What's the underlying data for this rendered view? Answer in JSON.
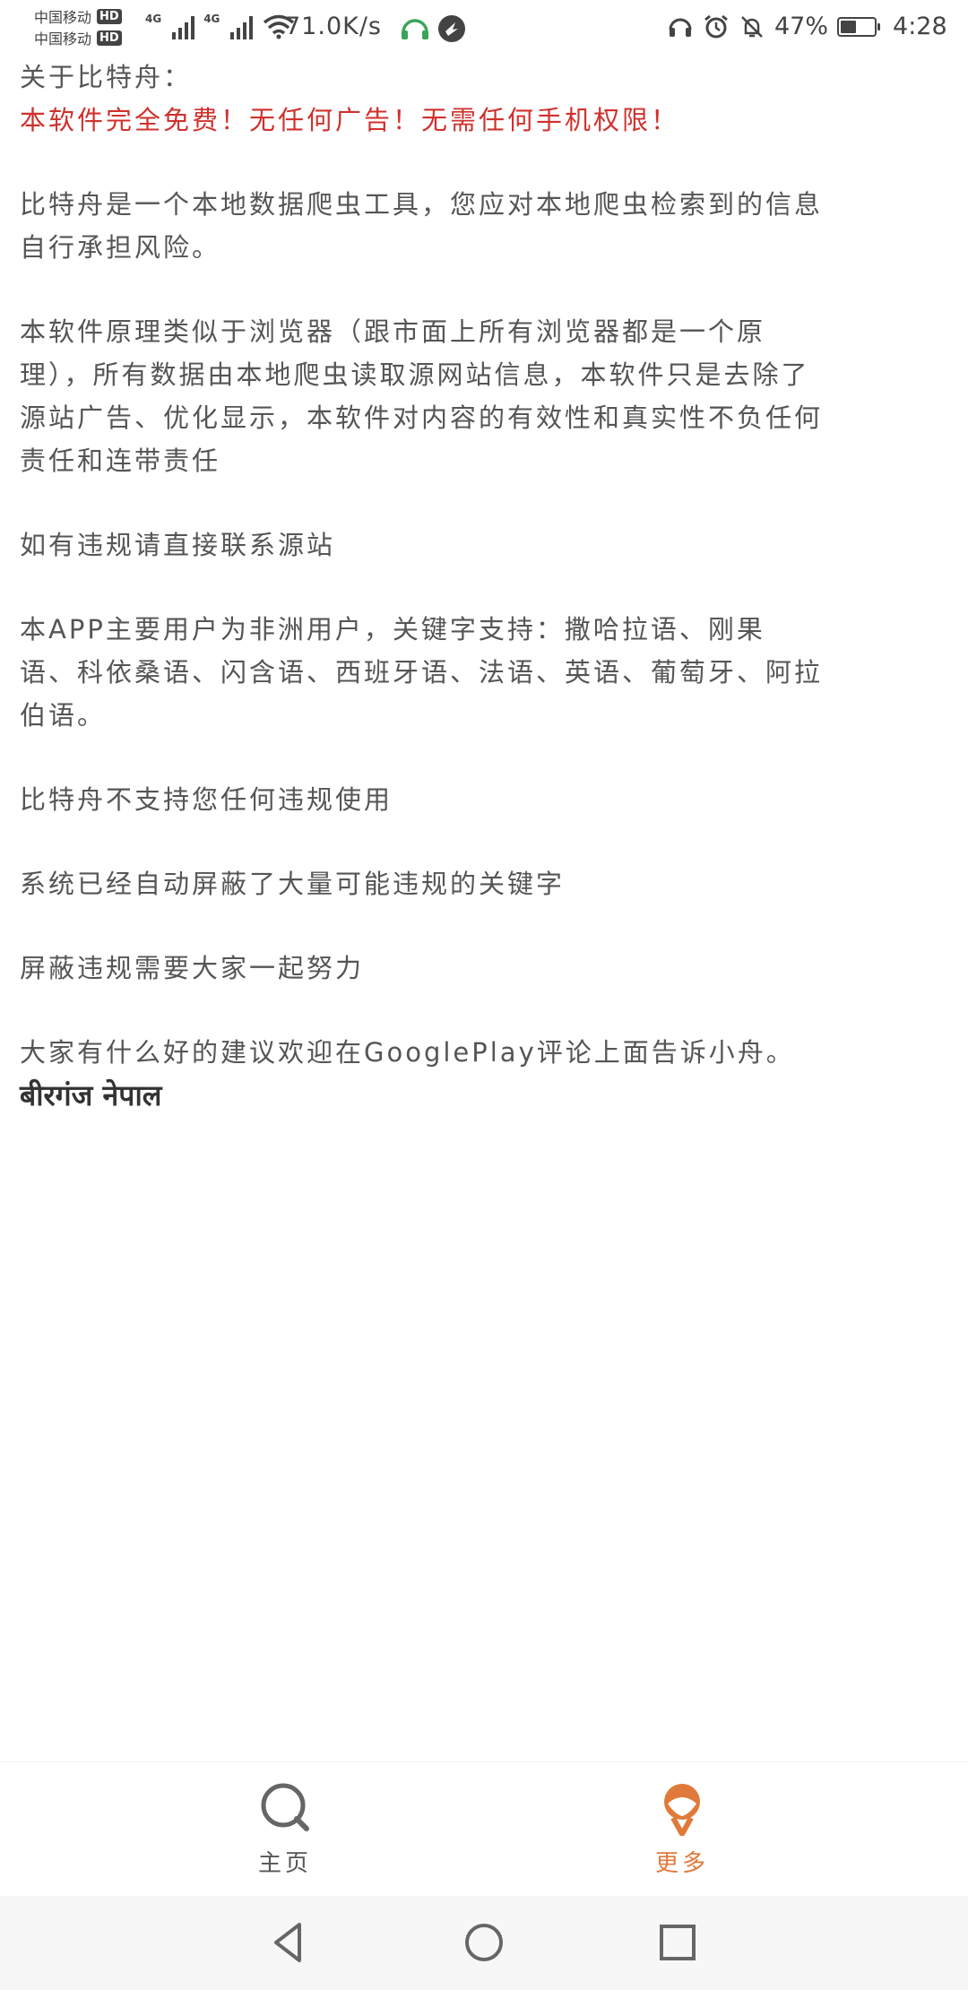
{
  "status_bar": {
    "carrier1": "中国移动",
    "carrier2": "中国移动",
    "hd_badge": "HD",
    "network_type_1": "4G",
    "network_type_2": "4G",
    "net_speed": "71.0K/s",
    "battery_percent": "47%",
    "battery_level": 0.47,
    "time": "4:28"
  },
  "content": {
    "title": "关于比特舟：",
    "highlight": "本软件完全免费！无任何广告！无需任何手机权限！",
    "p1_l1": "比特舟是一个本地数据爬虫工具，您应对本地爬虫检索到的信息",
    "p1_l2": "自行承担风险。",
    "p2_l1": "本软件原理类似于浏览器（跟市面上所有浏览器都是一个原",
    "p2_l2": "理），所有数据由本地爬虫读取源网站信息，本软件只是去除了",
    "p2_l3": "源站广告、优化显示，本软件对内容的有效性和真实性不负任何",
    "p2_l4": "责任和连带责任",
    "p3": "如有违规请直接联系源站",
    "p4_l1": "本APP主要用户为非洲用户，关键字支持：撒哈拉语、刚果",
    "p4_l2": "语、科依桑语、闪含语、西班牙语、法语、英语、葡萄牙、阿拉",
    "p4_l3": "伯语。",
    "p5": "比特舟不支持您任何违规使用",
    "p6": "系统已经自动屏蔽了大量可能违规的关键字",
    "p7": "屏蔽违规需要大家一起努力",
    "p8": "大家有什么好的建议欢迎在GooglePlay评论上面告诉小舟。",
    "nepali": "बीरगंज नेपाल"
  },
  "bottom_nav": {
    "home_label": "主页",
    "more_label": "更多",
    "accent": "#e07a3a"
  },
  "icons": [
    "search-icon",
    "more-icon",
    "back-icon",
    "home-circle-icon",
    "recent-apps-icon"
  ]
}
